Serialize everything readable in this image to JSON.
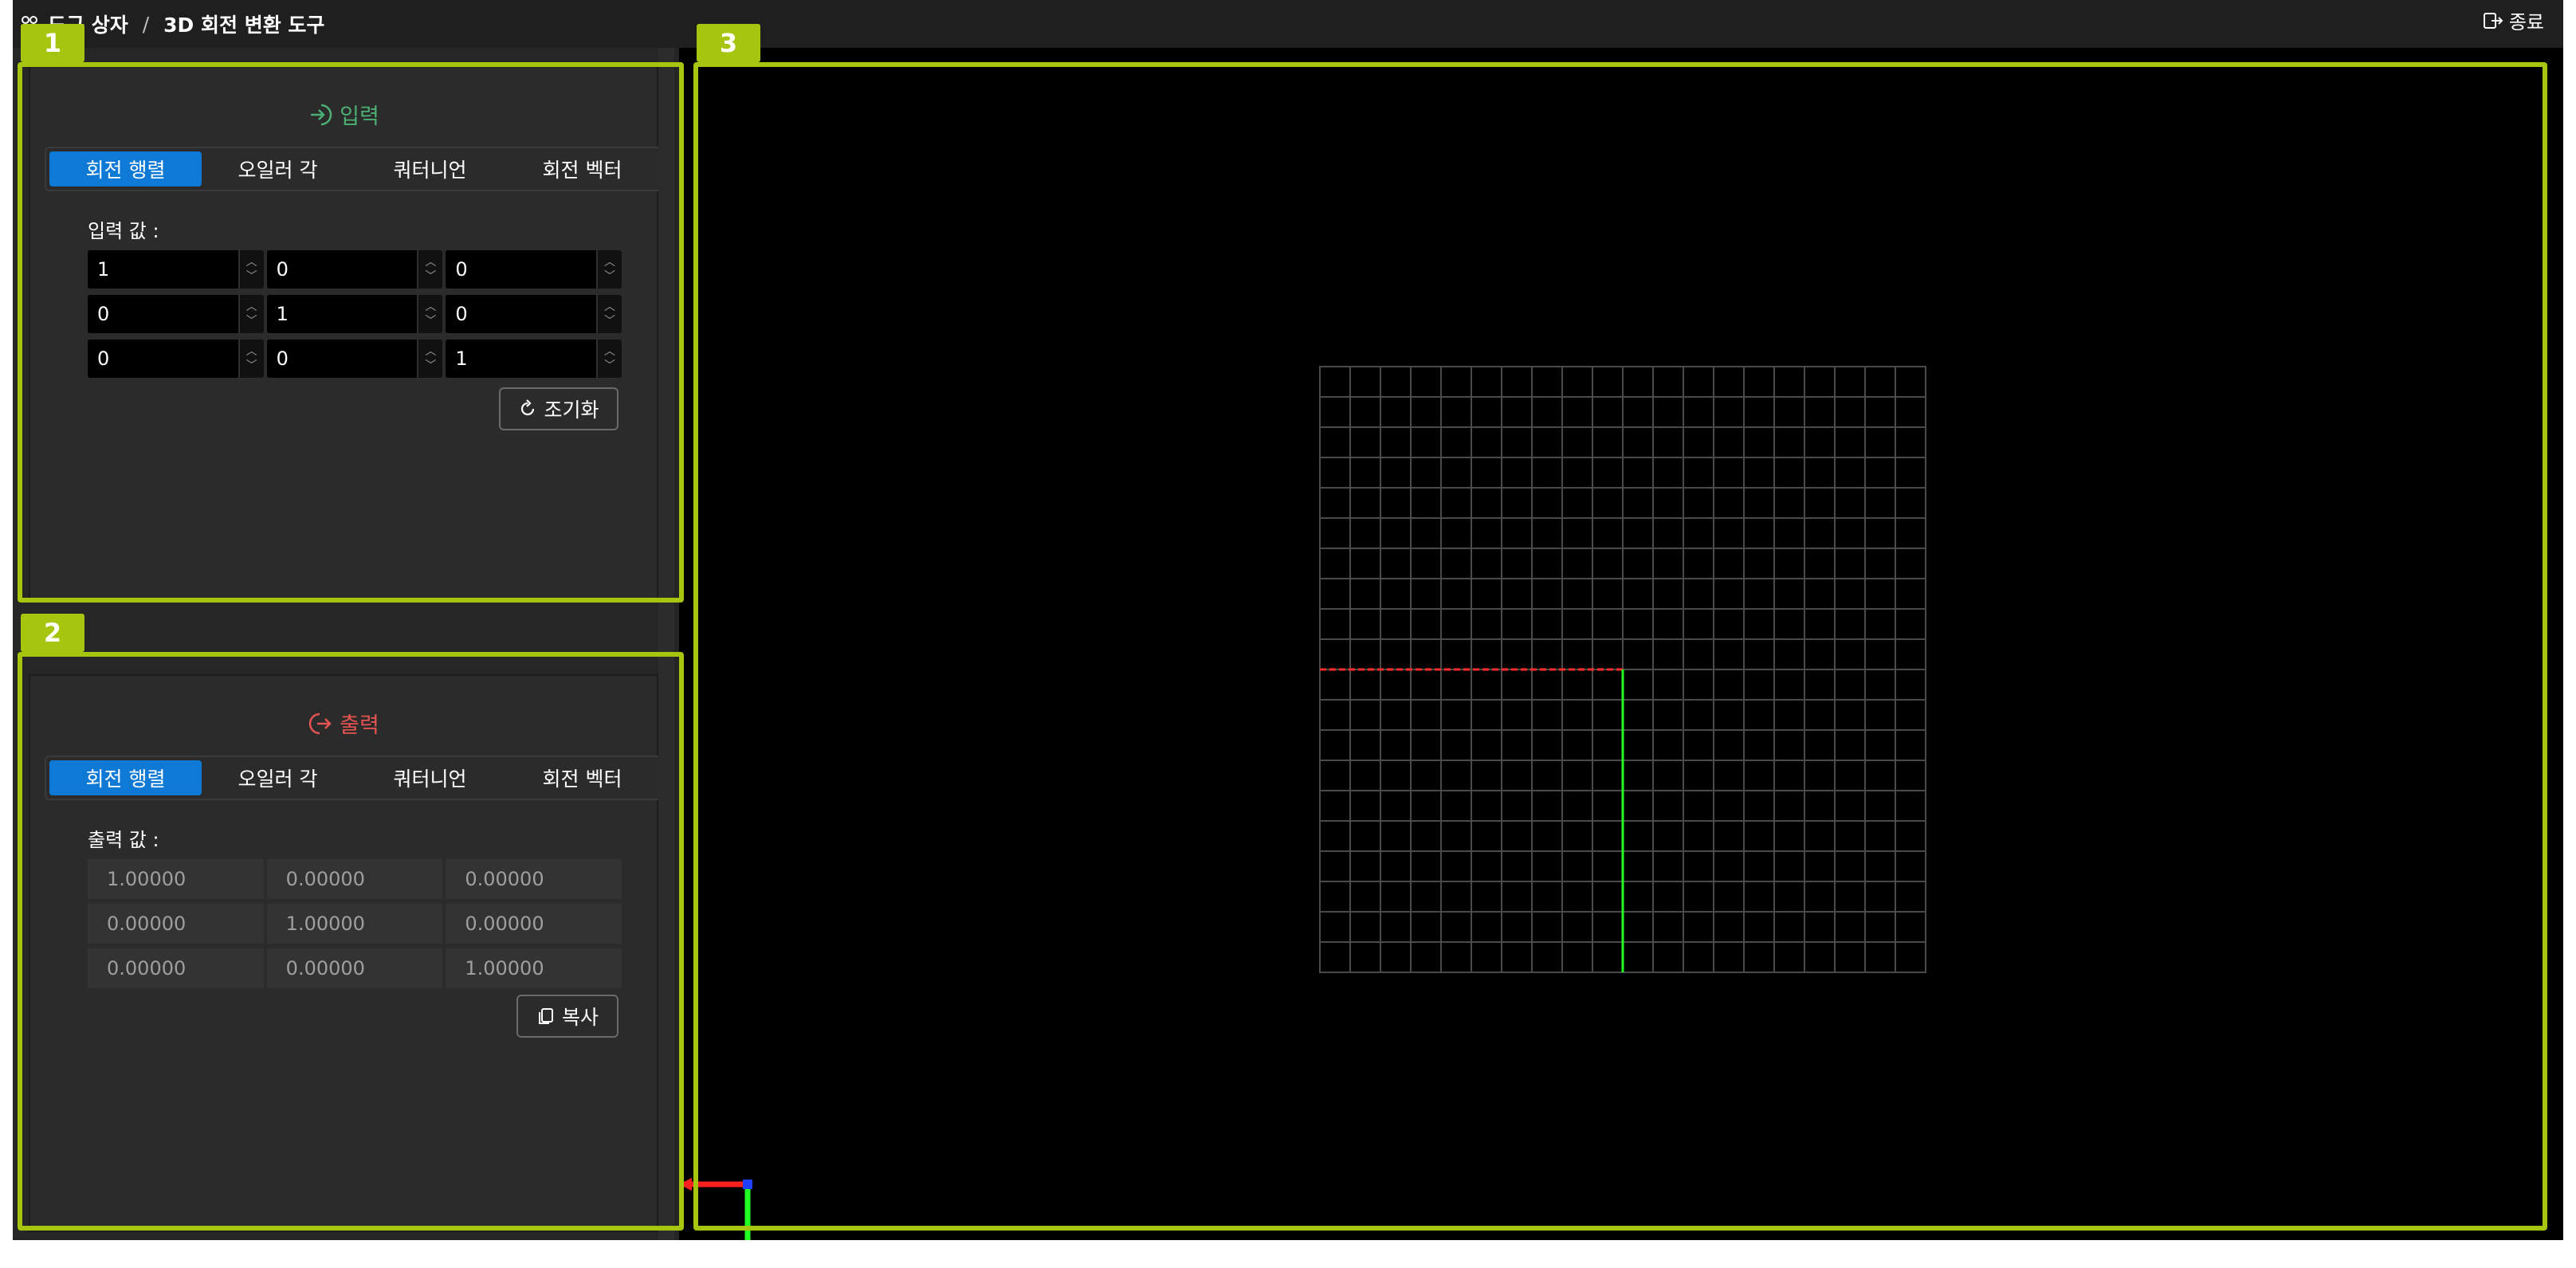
{
  "topbar": {
    "crumb_root": "도구 상자",
    "crumb_sep": "/",
    "crumb_current": "3D 회전 변환 도구",
    "exit_label": "종료"
  },
  "input_panel": {
    "title": "입력",
    "title_color": "#4caf73",
    "tabs": [
      "회전 행렬",
      "오일러 각",
      "쿼터니언",
      "회전 벡터"
    ],
    "active_tab": 0,
    "value_label": "입력 값 :",
    "matrix": [
      [
        "1",
        "0",
        "0"
      ],
      [
        "0",
        "1",
        "0"
      ],
      [
        "0",
        "0",
        "1"
      ]
    ],
    "reset_label": "조기화"
  },
  "output_panel": {
    "title": "출력",
    "title_color": "#e55353",
    "tabs": [
      "회전 행렬",
      "오일러 각",
      "쿼터니언",
      "회전 벡터"
    ],
    "active_tab": 0,
    "value_label": "출력 값 :",
    "matrix": [
      [
        "1.00000",
        "0.00000",
        "0.00000"
      ],
      [
        "0.00000",
        "1.00000",
        "0.00000"
      ],
      [
        "0.00000",
        "0.00000",
        "1.00000"
      ]
    ],
    "copy_label": "복사"
  },
  "annotations": {
    "tag1": "1",
    "tag2": "2",
    "tag3": "3"
  },
  "colors": {
    "accent": "#0e7ad6",
    "highlight": "#a6c50e",
    "axis_x": "#ff2020",
    "axis_y": "#22ff22",
    "axis_z": "#2040ff"
  }
}
